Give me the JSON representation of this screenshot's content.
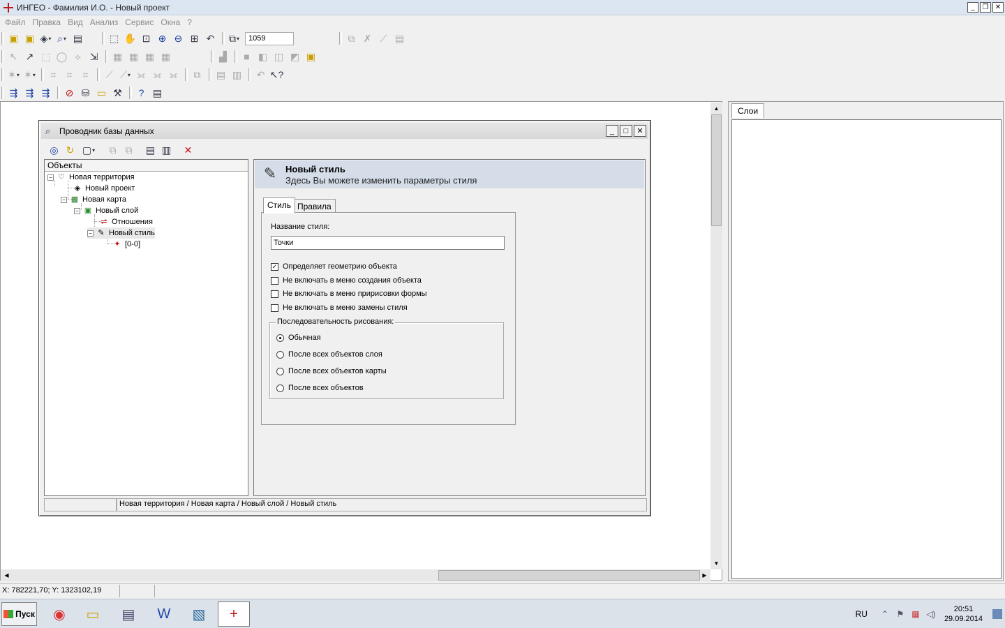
{
  "app": {
    "title": "ИНГЕО - Фамилия И.О. - Новый проект",
    "window_buttons": [
      "_",
      "❐",
      "✕"
    ]
  },
  "menu": [
    "Файл",
    "Правка",
    "Вид",
    "Анализ",
    "Сервис",
    "Окна",
    "?"
  ],
  "toolbar": {
    "zoom_value": "1059"
  },
  "layers_panel": {
    "tab_label": "Слои"
  },
  "statusbar": {
    "coords": "X: 782221,70; Y: 1323102,19"
  },
  "dialog": {
    "title": "Проводник базы данных",
    "window_buttons": [
      "_",
      "□",
      "✕"
    ],
    "tree_header": "Объекты",
    "tree": [
      {
        "label": "Новая территория",
        "icon": "territory-icon"
      },
      {
        "label": "Новый проект",
        "icon": "project-icon"
      },
      {
        "label": "Новая карта",
        "icon": "map-icon"
      },
      {
        "label": "Новый слой",
        "icon": "layer-icon"
      },
      {
        "label": "Отношения",
        "icon": "relations-icon"
      },
      {
        "label": "Новый стиль",
        "icon": "style-icon"
      },
      {
        "label": "[0-0]",
        "icon": "point-icon"
      }
    ],
    "header_title": "Новый стиль",
    "header_subtitle": "Здесь Вы можете изменить параметры стиля",
    "tabs": [
      "Стиль",
      "Правила"
    ],
    "style_name_label": "Название стиля:",
    "style_name_value": "Точки",
    "checkboxes": [
      {
        "label": "Определяет геометрию объекта",
        "checked": true
      },
      {
        "label": "Не включать в меню создания объекта",
        "checked": false
      },
      {
        "label": "Не включать в меню пририсовки формы",
        "checked": false
      },
      {
        "label": "Не включать в меню замены стиля",
        "checked": false
      }
    ],
    "draw_order_label": "Последовательность рисования:",
    "draw_order_options": [
      {
        "label": "Обычная",
        "selected": true
      },
      {
        "label": "После всех объектов слоя",
        "selected": false
      },
      {
        "label": "После всех объектов карты",
        "selected": false
      },
      {
        "label": "После всех объектов",
        "selected": false
      }
    ],
    "status_path": "Новая территория / Новая карта / Новый слой / Новый стиль"
  },
  "taskbar": {
    "start_label": "Пуск",
    "lang": "RU",
    "time": "20:51",
    "date": "29.09.2014"
  }
}
